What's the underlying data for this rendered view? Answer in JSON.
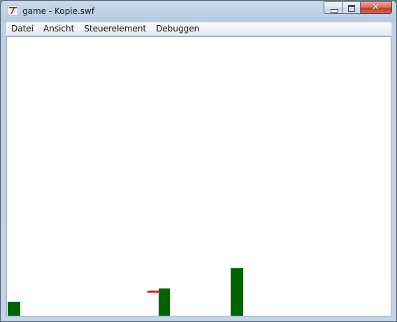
{
  "window": {
    "title": "game - Kopie.swf",
    "icon": "flash-player-icon",
    "controls": {
      "minimize_icon": "minimize-icon",
      "maximize_icon": "maximize-icon",
      "close_glyph": "✕"
    }
  },
  "menu": {
    "items": [
      {
        "label": "Datei"
      },
      {
        "label": "Ansicht"
      },
      {
        "label": "Steuerelement"
      },
      {
        "label": "Debuggen"
      }
    ]
  },
  "stage": {
    "background": "#ffffff",
    "obstacle_color": "#006400",
    "player_color": "#d12020"
  }
}
